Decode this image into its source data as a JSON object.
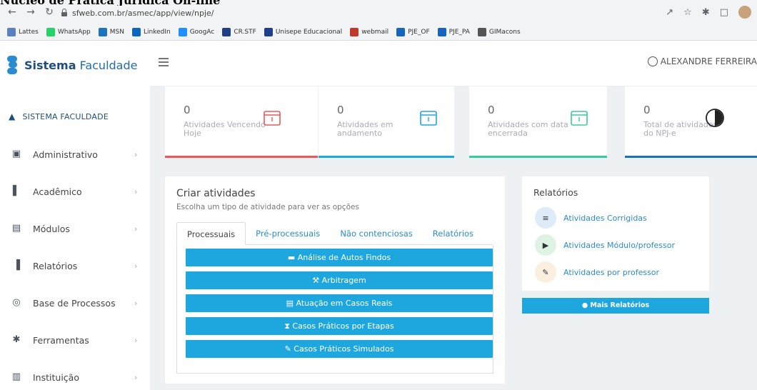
{
  "browser": {
    "tab_title": "Núcleo de Prática Jurídica On-line",
    "url": "sfweb.com.br/asmec/app/view/npje/",
    "back_icon": "arrow-left-icon",
    "forward_icon": "arrow-right-icon",
    "reload_icon": "reload-icon",
    "bookmarks": [
      {
        "label": "Lattes",
        "color": "#5b7fbf"
      },
      {
        "label": "WhatsApp",
        "color": "#25d366"
      },
      {
        "label": "MSN",
        "color": "#1e73be"
      },
      {
        "label": "LinkedIn",
        "color": "#0a66c2"
      },
      {
        "label": "GoogAc",
        "color": "#1e90ff"
      },
      {
        "label": "CR.STF",
        "color": "#1f3f8a"
      },
      {
        "label": "Unisepe Educacional",
        "color": "#1f3f8a"
      },
      {
        "label": "webmail",
        "color": "#c0392b"
      },
      {
        "label": "PJE_OF",
        "color": "#1565c0"
      },
      {
        "label": "PJE_PA",
        "color": "#1565c0"
      },
      {
        "label": "GIMacons",
        "color": "#555555"
      }
    ]
  },
  "app": {
    "logo_bold": "Sistema",
    "logo_rest": " Faculdade",
    "sidebar_header": "SISTEMA FACULDADE",
    "menu": [
      {
        "label": "Administrativo",
        "icon": "briefcase-icon"
      },
      {
        "label": "Acadêmico",
        "icon": "book-icon"
      },
      {
        "label": "Módulos",
        "icon": "window-icon"
      },
      {
        "label": "Relatórios",
        "icon": "bar-chart-icon"
      },
      {
        "label": "Base de Processos",
        "icon": "database-icon"
      },
      {
        "label": "Ferramentas",
        "icon": "asterisk-icon"
      },
      {
        "label": "Instituição",
        "icon": "building-icon"
      }
    ],
    "user_name": "ALEXANDRE FERREIRA"
  },
  "stats": [
    {
      "value": "0",
      "label": "Atividades Vencendo Hoje",
      "color": "#e8595b"
    },
    {
      "value": "0",
      "label": "Atividades em andamento",
      "color": "#1ea7df"
    },
    {
      "value": "0",
      "label": "Atividades com data encerrada",
      "color": "#3cc8a0"
    },
    {
      "value": "0",
      "label": "Total de atividades do NPJ-e",
      "color": "#1f6fbf"
    }
  ],
  "create": {
    "title": "Criar atividades",
    "subtitle": "Escolha um tipo de atividade para ver as opções",
    "tabs": [
      "Processuais",
      "Pré-processuais",
      "Não contenciosas",
      "Relatórios"
    ],
    "buttons": [
      {
        "label": "Análise de Autos Findos",
        "icon": "folder-icon"
      },
      {
        "label": "Arbitragem",
        "icon": "gavel-icon"
      },
      {
        "label": "Atuação em Casos Reais",
        "icon": "document-icon"
      },
      {
        "label": "Casos Práticos por Etapas",
        "icon": "hourglass-icon"
      },
      {
        "label": "Casos Práticos Simulados",
        "icon": "pencil-icon"
      }
    ]
  },
  "reports": {
    "title": "Relatórios",
    "items": [
      {
        "label": "Atividades Corrigidas",
        "icon": "list-icon",
        "bg": "#dcebf7"
      },
      {
        "label": "Atividades Módulo/professor",
        "icon": "folder-open-icon",
        "bg": "#dff3e4"
      },
      {
        "label": "Atividades por professor",
        "icon": "edit-icon",
        "bg": "#fbf0e0"
      }
    ],
    "more_label": "Mais Relatórios"
  }
}
